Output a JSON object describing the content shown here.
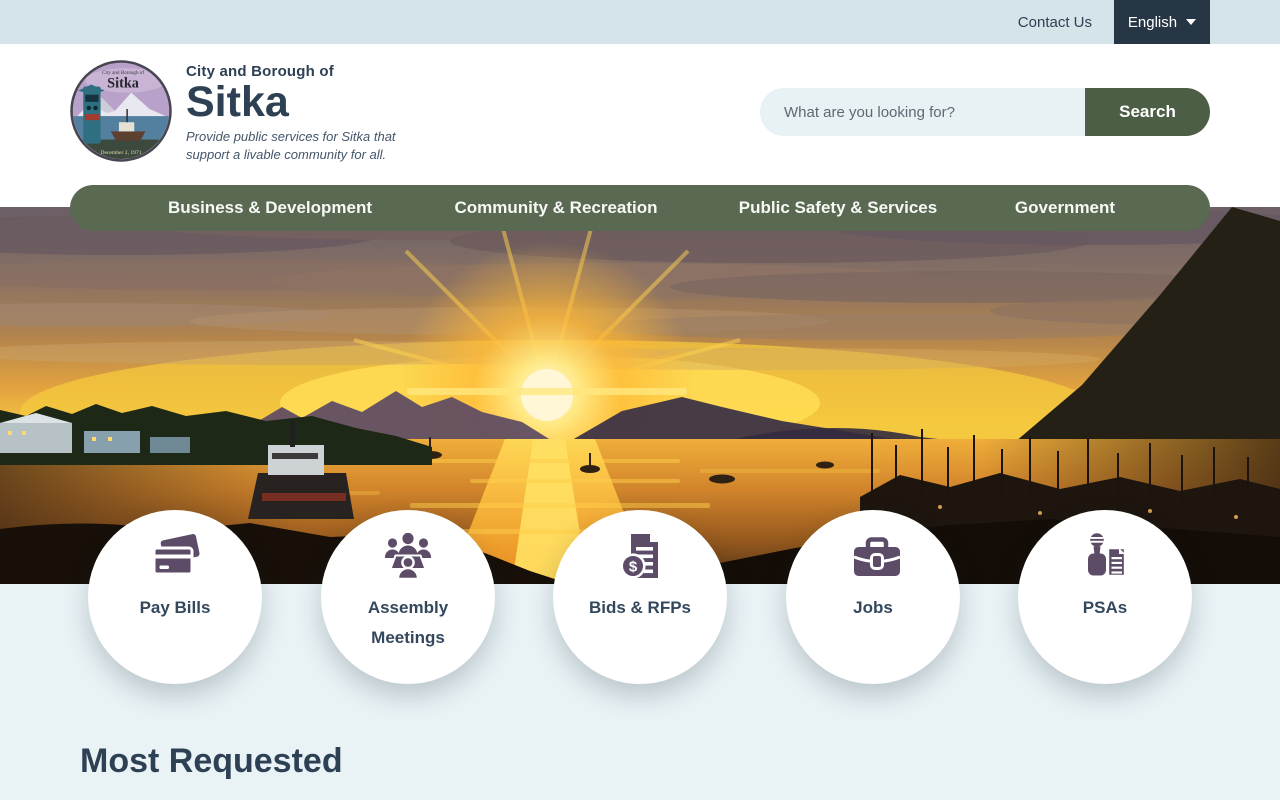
{
  "topbar": {
    "contact_label": "Contact Us",
    "language": {
      "label": "English"
    }
  },
  "brand": {
    "pretitle": "City and Borough of",
    "title": "Sitka",
    "tagline": {
      "line1": "Provide public services for Sitka that",
      "line2": "support a livable community for all."
    },
    "seal": {
      "arc": "City and Borough of",
      "name": "Sitka",
      "date": "December 2, 1971"
    }
  },
  "search": {
    "placeholder": "What are you looking for?",
    "button_label": "Search"
  },
  "nav": {
    "items": [
      {
        "label": "Business & Development"
      },
      {
        "label": "Community & Recreation"
      },
      {
        "label": "Public Safety & Services"
      },
      {
        "label": "Government"
      }
    ]
  },
  "quick_links": {
    "items": [
      {
        "label": "Pay Bills",
        "icon": "credit-cards-icon"
      },
      {
        "label": "Assembly Meetings",
        "icon": "meeting-people-icon"
      },
      {
        "label": "Bids & RFPs",
        "icon": "document-dollar-icon"
      },
      {
        "label": "Jobs",
        "icon": "briefcase-icon"
      },
      {
        "label": "PSAs",
        "icon": "microphone-news-icon"
      }
    ]
  },
  "section": {
    "title": "Most Requested"
  },
  "hero": {
    "alt": "Sunset over Sitka harbor with mountains, boats and marina"
  },
  "colors": {
    "topbar_bg": "#d5e4e9",
    "language_button_bg": "#263645",
    "nav_bg": "#5a6952",
    "search_button_bg": "#4d5e47",
    "search_field_bg": "#e8f1f3",
    "heading_text": "#2e4154",
    "quick_link_icon": "#5d4c68",
    "section_bg": "#e9f3f6"
  }
}
